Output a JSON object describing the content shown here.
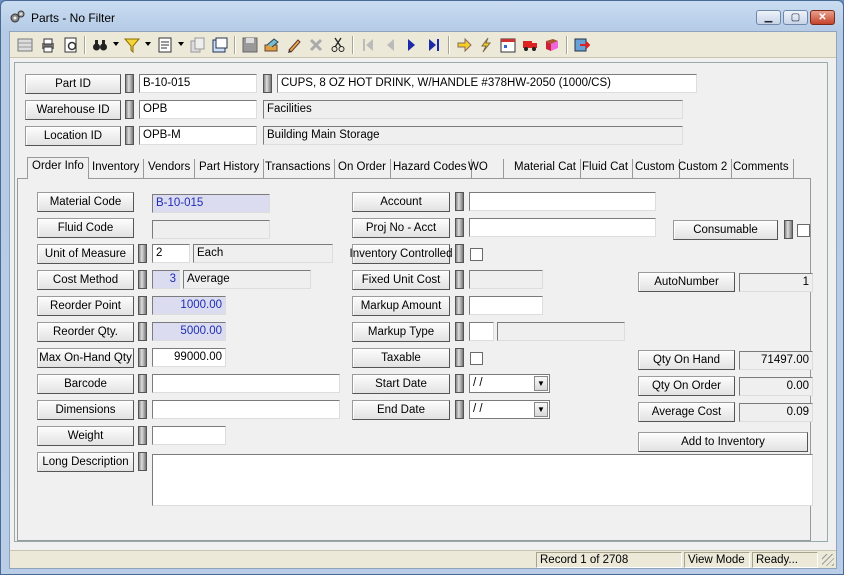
{
  "window": {
    "title": "Parts - No Filter",
    "min": "▁",
    "max": "▢",
    "close": "✕"
  },
  "toolbar": {
    "icons": [
      "grid-icon",
      "print-icon",
      "print-preview-icon",
      "binoculars-icon",
      "filter-icon",
      "report-icon",
      "copy-icon",
      "new-window-icon",
      "save-icon",
      "post-icon",
      "edit-icon",
      "delete-icon",
      "cut-icon",
      "first-record-icon",
      "prev-record-icon",
      "next-record-icon",
      "last-record-icon",
      "arrow-icon",
      "lightning-icon",
      "calendar-icon",
      "truck-icon",
      "book-icon",
      "exit-icon"
    ]
  },
  "header": {
    "part_id_label": "Part ID",
    "part_id": "B-10-015",
    "part_desc": "CUPS, 8 OZ HOT DRINK, W/HANDLE #378HW-2050 (1000/CS)",
    "warehouse_label": "Warehouse ID",
    "warehouse": "OPB",
    "warehouse_desc": "Facilities",
    "location_label": "Location ID",
    "location": "OPB-M",
    "location_desc": "Building Main Storage"
  },
  "tabs": [
    "Order Info",
    "Inventory",
    "Vendors",
    "Part History",
    "Transactions",
    "On Order",
    "Hazard Codes",
    "WO",
    "Material Cat",
    "Fluid Cat",
    "Custom",
    "Custom 2",
    "Comments"
  ],
  "left": {
    "material_code_label": "Material Code",
    "material_code": "B-10-015",
    "fluid_code_label": "Fluid Code",
    "fluid_code": "",
    "uom_label": "Unit of Measure",
    "uom_code": "2",
    "uom_desc": "Each",
    "cost_method_label": "Cost Method",
    "cost_method_code": "3",
    "cost_method_desc": "Average",
    "reorder_point_label": "Reorder Point",
    "reorder_point": "1000.00",
    "reorder_qty_label": "Reorder Qty.",
    "reorder_qty": "5000.00",
    "max_onhand_label": "Max On-Hand Qty",
    "max_onhand": "99000.00",
    "barcode_label": "Barcode",
    "barcode": "",
    "dimensions_label": "Dimensions",
    "dimensions": "",
    "weight_label": "Weight",
    "weight": "",
    "long_desc_label": "Long Description",
    "long_desc": ""
  },
  "middle": {
    "account_label": "Account",
    "account": "",
    "proj_label": "Proj No - Acct",
    "proj": "",
    "inv_controlled_label": "Inventory Controlled",
    "fixed_cost_label": "Fixed Unit Cost",
    "fixed_cost": "",
    "markup_amount_label": "Markup Amount",
    "markup_amount": "",
    "markup_type_label": "Markup Type",
    "markup_type": "",
    "markup_type_desc": "",
    "taxable_label": "Taxable",
    "start_date_label": "Start Date",
    "start_date": " /  /",
    "end_date_label": "End Date",
    "end_date": " /  /"
  },
  "right": {
    "consumable_label": "Consumable",
    "autonumber_label": "AutoNumber",
    "autonumber": "1",
    "qty_onhand_label": "Qty On Hand",
    "qty_onhand": "71497.00",
    "qty_onorder_label": "Qty On Order",
    "qty_onorder": "0.00",
    "avg_cost_label": "Average Cost",
    "avg_cost": "0.09",
    "add_inventory_label": "Add to Inventory"
  },
  "status": {
    "record": "Record 1 of 2708",
    "mode": "View Mode",
    "state": "Ready..."
  }
}
